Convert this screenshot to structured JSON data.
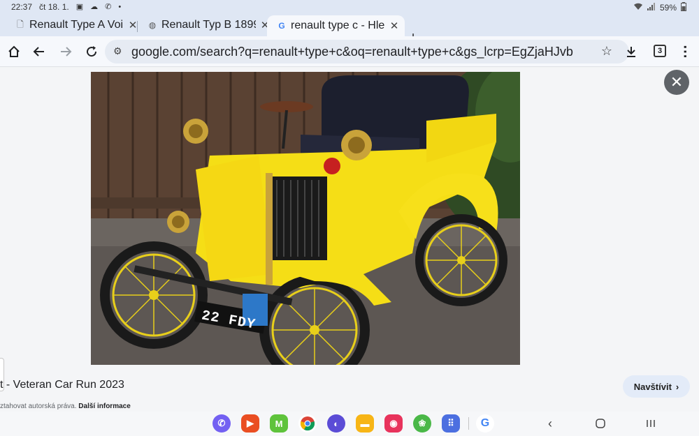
{
  "status_bar": {
    "time": "22:37",
    "date": "čt 18. 1.",
    "battery": "59%",
    "icons": [
      "gallery-icon",
      "cloud-icon",
      "viber-icon",
      "dot-icon",
      "wifi-icon",
      "signal-icon",
      "battery-icon"
    ]
  },
  "tabs": [
    {
      "title": "Renault Type A Voi",
      "favicon": "page-icon",
      "active": false
    },
    {
      "title": "Renault Typ B 1899",
      "favicon": "globe-icon",
      "active": false
    },
    {
      "title": "renault type c - Hle",
      "favicon": "google-g-icon",
      "active": true
    }
  ],
  "new_tab_label": "+",
  "toolbar": {
    "url": "google.com/search?q=renault+type+c&oq=renault+type+c&gs_lcrp=EgZjaHJvb",
    "tab_count": "3"
  },
  "image_viewer": {
    "image_alt": "Yellow Renault Type C veteran car",
    "plate": "22 FDY",
    "result_title": "t - Veteran Car Run 2023",
    "visit_label": "Navštívit",
    "copyright_text": "ztahovat autorská práva.",
    "more_info": "Další informace"
  },
  "colors": {
    "car_yellow": "#f5de16",
    "status_bar_bg": "#dfe7f4",
    "visit_button_bg": "#e3ebf8"
  },
  "dock": {
    "apps": [
      "viber-icon",
      "office-icon",
      "m-icon",
      "chrome-icon",
      "internet-icon",
      "files-icon",
      "camera-icon",
      "gallery-icon",
      "apps-grid-icon",
      "google-icon"
    ]
  }
}
